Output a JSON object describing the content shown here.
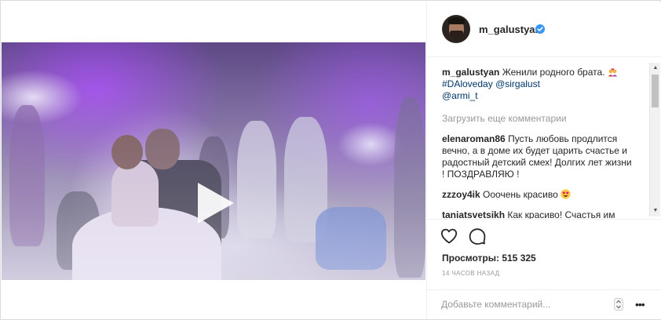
{
  "post": {
    "author": "m_galustyan",
    "verified": true,
    "media": {
      "type": "video",
      "play_icon": "play-icon"
    },
    "caption": {
      "username": "m_galustyan",
      "text": "Женили родного брата.",
      "emoji": "couple-with-heart-emoji",
      "hashtag": "#DAloveday",
      "mentions": [
        "@sirgalust",
        "@armi_t"
      ]
    },
    "load_more_label": "Загрузить еще комментарии",
    "comments": [
      {
        "username": "elenaroman86",
        "text": "Пусть любовь продлится вечно, а в доме их будет царить счастье и радостный детский смех! Долгих лет жизни ! ПОЗДРАВЛЯЮ !"
      },
      {
        "username": "zzzoy4ik",
        "text": "Ооочень красиво",
        "emoji": "heart-eyes-emoji"
      },
      {
        "username": "taniatsvetsikh",
        "text": "Как красиво! Счастья им большого"
      }
    ],
    "views_label": "Просмотры: 515 325",
    "timestamp": "14 часов назад",
    "add_comment_placeholder": "Добавьте комментарий...",
    "options_label": "•••",
    "scroll_up_label": "▲",
    "scroll_down_label": "▼"
  },
  "colors": {
    "text": "#262626",
    "link": "#003569",
    "muted": "#999999",
    "verified": "#3897f0",
    "border": "#efefef"
  }
}
